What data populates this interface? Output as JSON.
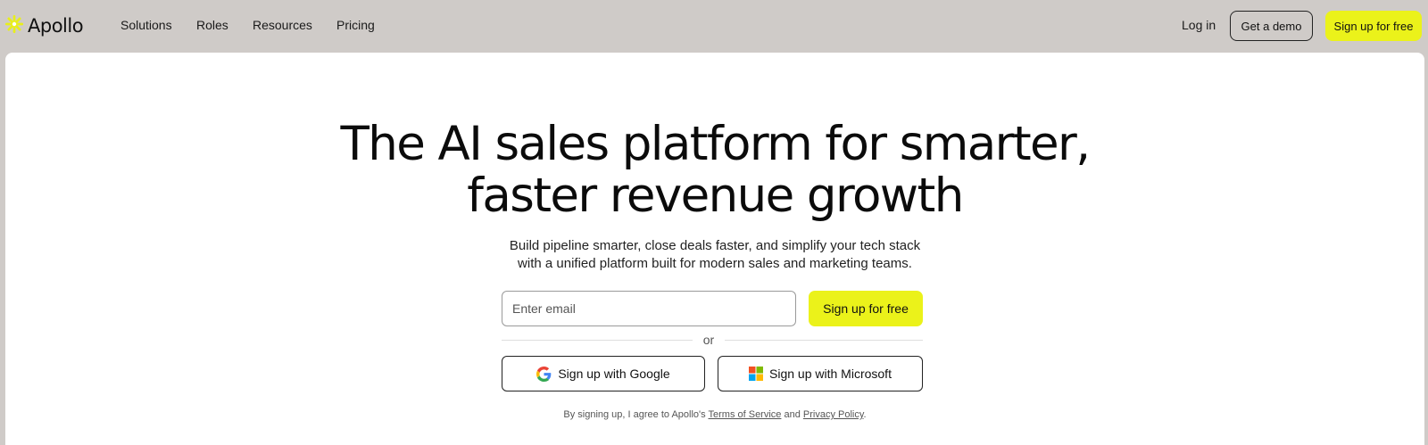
{
  "header": {
    "brand": "Apollo",
    "nav": [
      "Solutions",
      "Roles",
      "Resources",
      "Pricing"
    ],
    "login_label": "Log in",
    "demo_label": "Get a demo",
    "signup_label": "Sign up for free"
  },
  "hero": {
    "title_line1": "The AI sales platform for smarter,",
    "title_line2": "faster revenue growth",
    "subtitle_line1": "Build pipeline smarter, close deals faster, and simplify your tech stack",
    "subtitle_line2": "with a unified platform built for modern sales and marketing teams."
  },
  "signup_form": {
    "email_placeholder": "Enter email",
    "email_value": "",
    "submit_label": "Sign up for free",
    "divider_text": "or",
    "google_label": "Sign up with Google",
    "microsoft_label": "Sign up with Microsoft",
    "terms_prefix": "By signing up, I agree to Apollo's ",
    "terms_link": "Terms of Service",
    "terms_middle": " and ",
    "privacy_link": "Privacy Policy",
    "terms_suffix": "."
  },
  "icons": {
    "brand": "apollo-asterisk-icon",
    "google": "google-g-icon",
    "microsoft": "microsoft-logo-icon"
  },
  "colors": {
    "accent": "#ebf21a",
    "page_bg": "#cfcbc8",
    "card_bg": "#ffffff"
  }
}
